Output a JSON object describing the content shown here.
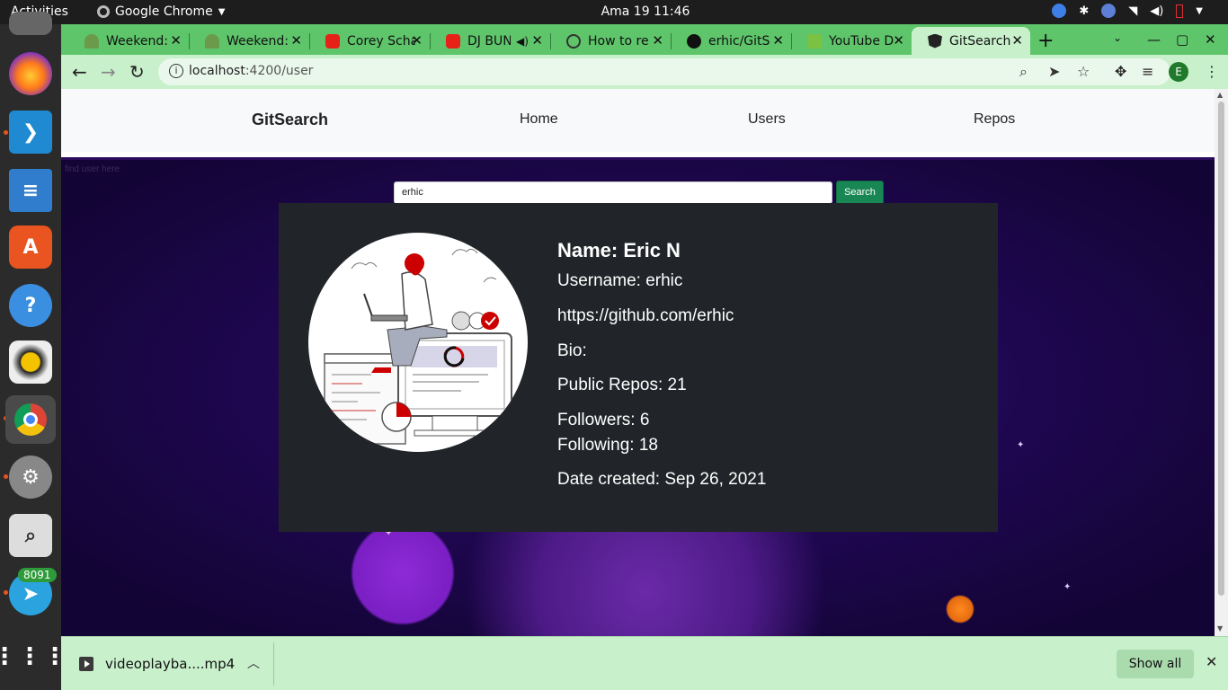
{
  "system": {
    "activities": "Activities",
    "app_name": "Google Chrome",
    "clock": "Ama 19  11:46",
    "dock_badge": "8091"
  },
  "browser": {
    "tabs": [
      {
        "title": "Weekend:",
        "icon": "tree-icon",
        "color": "#5a8a3a"
      },
      {
        "title": "Weekend:",
        "icon": "tree-icon",
        "color": "#5a8a3a"
      },
      {
        "title": "Corey Scha",
        "icon": "youtube-icon",
        "color": "#e62117"
      },
      {
        "title": "DJ BUN",
        "icon": "youtube-icon",
        "color": "#e62117"
      },
      {
        "title": "How to re",
        "icon": "globe-icon",
        "color": "#333333"
      },
      {
        "title": "erhic/GitS",
        "icon": "github-icon",
        "color": "#111111"
      },
      {
        "title": "YouTube D",
        "icon": "download-icon",
        "color": "#7bc142"
      },
      {
        "title": "GitSearch",
        "icon": "angular-icon",
        "color": "#222222"
      }
    ],
    "url_host": "localhost",
    "url_path": ":4200/user",
    "profile_initial": "E"
  },
  "site": {
    "brand": "GitSearch",
    "nav": [
      "Home",
      "Users",
      "Repos"
    ],
    "search_hint": "find user here",
    "search_value": "erhic",
    "search_button": "Search"
  },
  "profile": {
    "name": "Name: Eric N",
    "username": "Username: erhic",
    "url": "https://github.com/erhic",
    "bio": "Bio:",
    "public_repos": "Public Repos: 21",
    "followers": "Followers: 6",
    "following": "Following: 18",
    "created": "Date created: Sep 26, 2021"
  },
  "downloads": {
    "file": "videoplayba....mp4",
    "show_all": "Show all"
  },
  "colors": {
    "tab_strip": "#5ec56b",
    "toolbar": "#c8f0cb",
    "card": "#212529",
    "search_button": "#198754"
  }
}
